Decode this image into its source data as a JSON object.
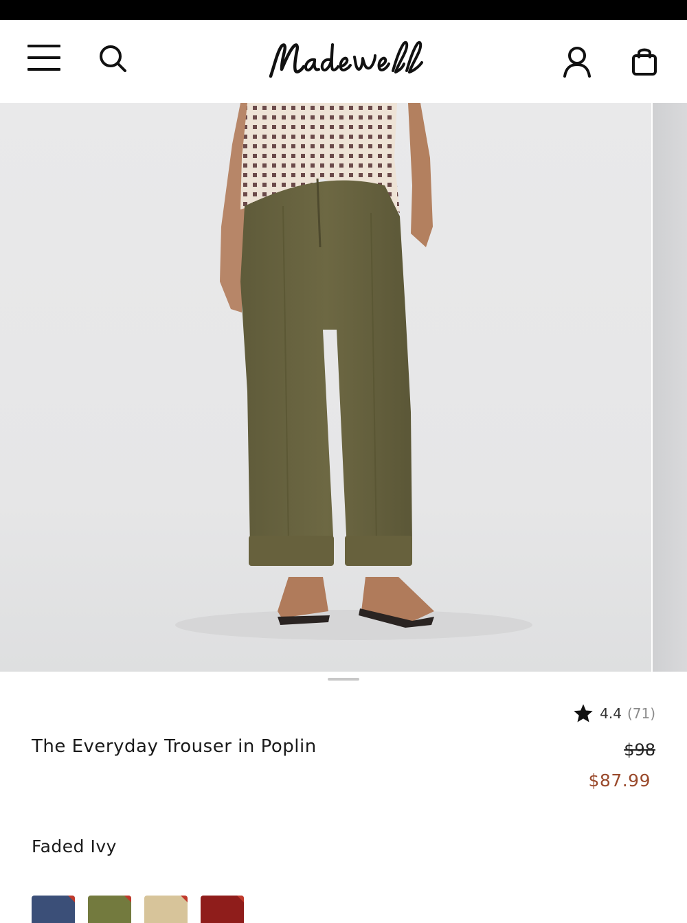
{
  "header": {
    "brand": "Madewell",
    "icons": [
      "menu-icon",
      "search-icon",
      "account-icon",
      "bag-icon"
    ]
  },
  "carousel": {
    "active_index": 0
  },
  "product": {
    "name": "The Everyday Trouser in Poplin",
    "rating": "4.4",
    "review_count": "(71)",
    "price_original": "$98",
    "price_sale": "$87.99",
    "selected_color": "Faded Ivy"
  },
  "swatches": [
    {
      "color": "#3b4f78",
      "name": "navy"
    },
    {
      "color": "#737a3e",
      "name": "olive"
    },
    {
      "color": "#d7c49a",
      "name": "khaki"
    },
    {
      "color": "#8f1d1b",
      "name": "red"
    }
  ],
  "colors": {
    "sale": "#9a4a2c",
    "text": "#1a1a1a",
    "muted": "#8a8a8a"
  }
}
